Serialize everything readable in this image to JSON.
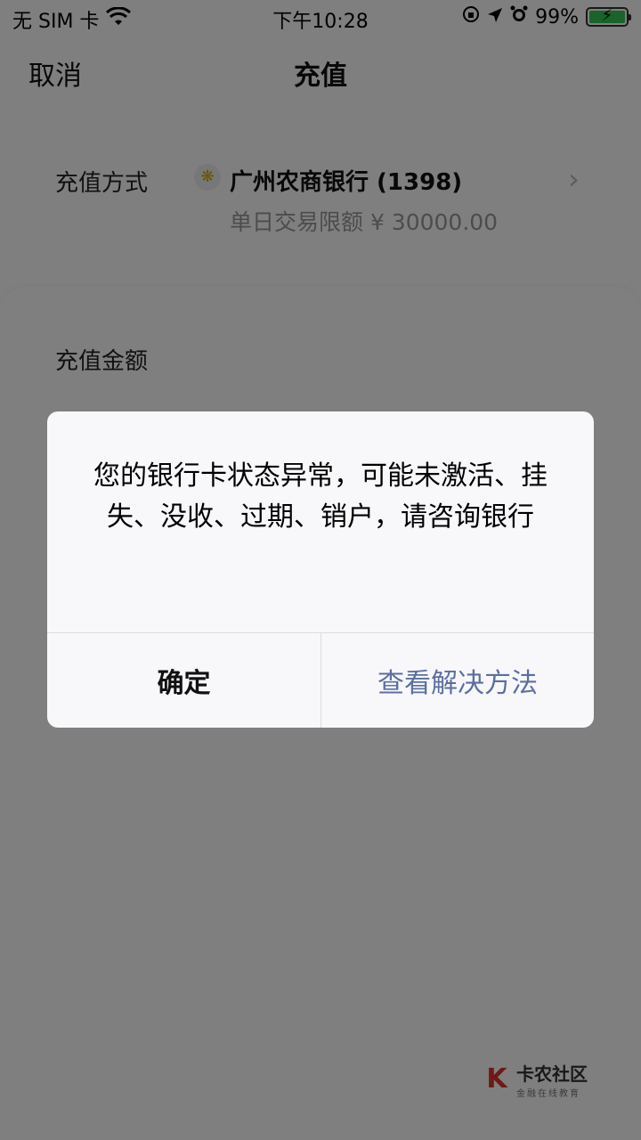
{
  "status_bar": {
    "carrier": "无 SIM 卡",
    "time": "下午10:28",
    "battery_percent": "99%",
    "battery_level": 0.99,
    "icons": [
      "wifi-icon",
      "orientation-lock-icon",
      "location-icon",
      "alarm-icon",
      "battery-charging-icon"
    ]
  },
  "nav": {
    "cancel_label": "取消",
    "title": "充值"
  },
  "payment_method": {
    "label": "充值方式",
    "bank_name": "广州农商银行 (1398)",
    "daily_limit": "单日交易限额 ¥ 30000.00",
    "bank_logo_glyph": "❋",
    "chevron_glyph": "›"
  },
  "amount": {
    "label": "充值金额"
  },
  "alert": {
    "message": "您的银行卡状态异常，可能未激活、挂失、没收、过期、销户，请咨询银行",
    "confirm_label": "确定",
    "solution_label": "查看解决方法",
    "solution_color": "#5b6fa0"
  },
  "watermark": {
    "logo_glyph": "K",
    "title": "卡农社区",
    "subtitle": "金融在线教育"
  }
}
